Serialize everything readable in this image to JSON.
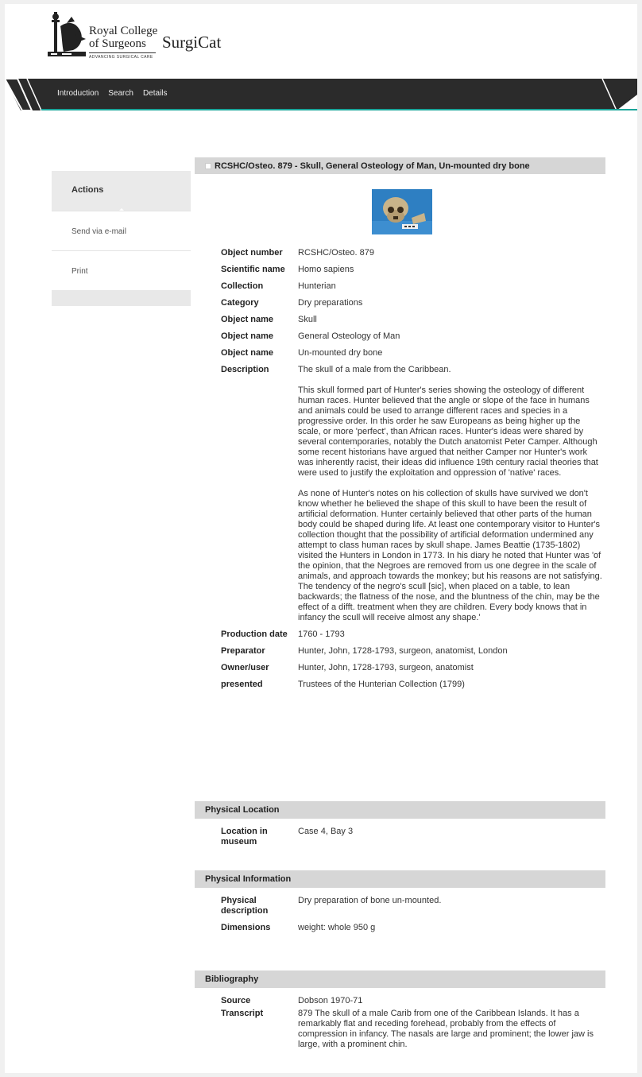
{
  "header": {
    "college_line1": "Royal College",
    "college_line2": "of Surgeons",
    "college_tagline": "ADVANCING SURGICAL CARE",
    "app_name": "SurgiCat"
  },
  "nav": {
    "items": [
      {
        "label": "Introduction"
      },
      {
        "label": "Search"
      },
      {
        "label": "Details"
      }
    ]
  },
  "sidebar": {
    "heading": "Actions",
    "items": [
      {
        "label": "Send via e-mail"
      },
      {
        "label": "Print"
      }
    ]
  },
  "record": {
    "title": "RCSHC/Osteo. 879 - Skull, General Osteology of Man, Un-mounted dry bone",
    "fields": [
      {
        "label": "Object number",
        "value": "RCSHC/Osteo. 879"
      },
      {
        "label": "Scientific name",
        "value": "Homo sapiens"
      },
      {
        "label": "Collection",
        "value": "Hunterian"
      },
      {
        "label": "Category",
        "value": "Dry preparations"
      },
      {
        "label": "Object name",
        "value": "Skull"
      },
      {
        "label": "Object name",
        "value": "General Osteology of Man"
      },
      {
        "label": "Object name",
        "value": "Un-mounted dry bone"
      }
    ],
    "description_label": "Description",
    "description": [
      "The skull of a male from the Caribbean.",
      "This skull formed part of Hunter's series showing the osteology of different human races. Hunter believed that the angle or slope of the face in humans and animals could be used to arrange different races and species in a progressive order. In this order he saw Europeans as being higher up the scale, or more 'perfect', than African races. Hunter's ideas were shared by several contemporaries, notably the Dutch anatomist Peter Camper. Although some recent historians have argued that neither Camper nor Hunter's work was inherently racist, their ideas did influence 19th century racial theories that were used to justify the exploitation and oppression of 'native' races.",
      "As none of Hunter's notes on his collection of skulls have survived we don't know whether he believed the shape of this skull to have been the result of artificial deformation. Hunter certainly believed that other parts of the human body could be shaped during life. At least one contemporary visitor to Hunter's collection thought that the possibility of artificial deformation undermined any attempt to class human races by skull shape. James Beattie (1735-1802) visited the Hunters in London in 1773. In his diary he noted that Hunter was 'of the opinion, that the Negroes are removed from us one degree in the scale of animals, and approach towards the monkey; but his reasons are not satisfying. The tendency of the negro's scull [sic], when placed on a table, to lean backwards; the flatness of the nose, and the bluntness of the chin, may be the effect of a difft. treatment when they are children. Every body knows that in infancy the scull will receive almost any shape.'"
    ],
    "fields_after": [
      {
        "label": "Production date",
        "value": "1760 - 1793"
      },
      {
        "label": "Preparator",
        "value": "Hunter, John, 1728-1793, surgeon, anatomist, London"
      },
      {
        "label": "Owner/user",
        "value": "Hunter, John, 1728-1793, surgeon, anatomist"
      },
      {
        "label": "presented",
        "value": "Trustees of the Hunterian Collection (1799)"
      }
    ]
  },
  "physical_location": {
    "heading": "Physical Location",
    "fields": [
      {
        "label": "Location in museum",
        "value": "Case 4, Bay 3"
      }
    ]
  },
  "physical_information": {
    "heading": "Physical Information",
    "fields": [
      {
        "label": "Physical description",
        "value": "Dry preparation of bone un-mounted."
      },
      {
        "label": "Dimensions",
        "value": "weight: whole 950 g"
      }
    ]
  },
  "bibliography": {
    "heading": "Bibliography",
    "fields": [
      {
        "label": "Source",
        "value": "Dobson 1970-71"
      },
      {
        "label": "Transcript",
        "value": "879  The skull of a male Carib from one of the Caribbean Islands. It has a remarkably flat and receding forehead, probably from the effects of compression in infancy. The nasals are large and prominent; the lower jaw is large, with a prominent chin."
      }
    ]
  },
  "colors": {
    "nav_bg": "#262626",
    "nav_accent": "#1aa59a",
    "section_bg": "#d6d6d6",
    "sidebar_bg": "#e8e8e8",
    "thumb_bg": "#2e7fc2"
  }
}
